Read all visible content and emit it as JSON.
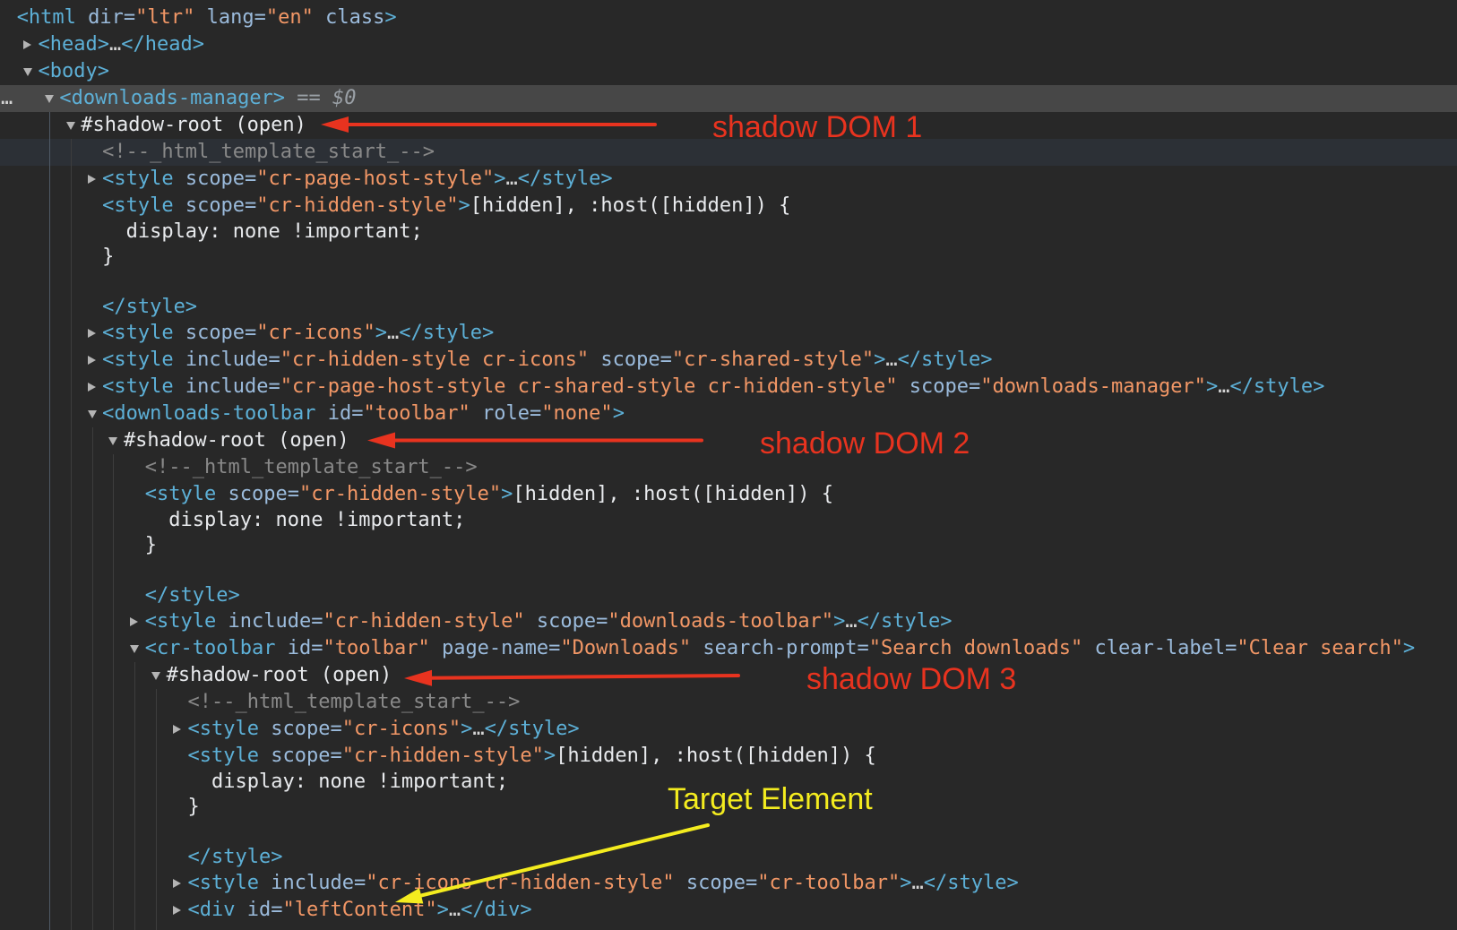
{
  "colors": {
    "background": "#282828",
    "tag": "#5db0d7",
    "attr": "#9bbbdc",
    "val": "#f29766",
    "text": "#e8eaed",
    "comment": "#898989",
    "shadow": "#e8eaed",
    "ell": "#d4d4d4",
    "ref": "#9aa0a6",
    "triangle": "#b4b4b4",
    "selected_row": "#474747",
    "hovered_row": "#2c3036",
    "guide": "#3d3d3d",
    "guide_active": "#4f5a66",
    "annotation_red": "#e8331f",
    "annotation_yellow": "#f4ec1f"
  },
  "tree": {
    "selected_gutter": "…",
    "rows": [
      {
        "level": 0,
        "type": "node",
        "toggle": "none",
        "tokens": [
          {
            "k": "tag",
            "t": "<html"
          },
          {
            "k": "attr",
            "t": " dir="
          },
          {
            "k": "val",
            "t": "\"ltr\""
          },
          {
            "k": "attr",
            "t": " lang="
          },
          {
            "k": "val",
            "t": "\"en\""
          },
          {
            "k": "attr",
            "t": " class"
          },
          {
            "k": "tag",
            "t": ">"
          }
        ]
      },
      {
        "level": 1,
        "type": "node",
        "toggle": "collapsed",
        "tokens": [
          {
            "k": "tag",
            "t": "<head>"
          },
          {
            "k": "ell",
            "t": "…"
          },
          {
            "k": "tag",
            "t": "</head>"
          }
        ]
      },
      {
        "level": 1,
        "type": "node",
        "toggle": "expanded",
        "tokens": [
          {
            "k": "tag",
            "t": "<body>"
          }
        ]
      },
      {
        "level": 2,
        "type": "node",
        "toggle": "expanded",
        "selected": true,
        "tokens": [
          {
            "k": "tag",
            "t": "<downloads-manager>"
          },
          {
            "k": "ref",
            "t": " == $0"
          }
        ]
      },
      {
        "level": 3,
        "type": "node",
        "toggle": "expanded",
        "tokens": [
          {
            "k": "shadow",
            "t": "#shadow-root (open)"
          }
        ]
      },
      {
        "level": 4,
        "type": "node",
        "toggle": "none",
        "hovered": true,
        "tokens": [
          {
            "k": "comment",
            "t": "<!--_html_template_start_-->"
          }
        ]
      },
      {
        "level": 4,
        "type": "node",
        "toggle": "collapsed",
        "tokens": [
          {
            "k": "tag",
            "t": "<style"
          },
          {
            "k": "attr",
            "t": " scope="
          },
          {
            "k": "val",
            "t": "\"cr-page-host-style\""
          },
          {
            "k": "tag",
            "t": ">"
          },
          {
            "k": "ell",
            "t": "…"
          },
          {
            "k": "tag",
            "t": "</style>"
          }
        ]
      },
      {
        "level": 4,
        "type": "node",
        "toggle": "none",
        "tokens": [
          {
            "k": "tag",
            "t": "<style"
          },
          {
            "k": "attr",
            "t": " scope="
          },
          {
            "k": "val",
            "t": "\"cr-hidden-style\""
          },
          {
            "k": "tag",
            "t": ">"
          },
          {
            "k": "text",
            "t": "[hidden], :host([hidden]) {"
          }
        ]
      },
      {
        "level": 4,
        "type": "line",
        "tokens": [
          {
            "k": "text",
            "t": "  display: none !important;"
          }
        ]
      },
      {
        "level": 4,
        "type": "line",
        "tokens": [
          {
            "k": "text",
            "t": "}"
          }
        ]
      },
      {
        "level": 4,
        "type": "line",
        "tokens": []
      },
      {
        "level": 4,
        "type": "line",
        "tokens": [
          {
            "k": "tag",
            "t": "</style>"
          }
        ]
      },
      {
        "level": 4,
        "type": "node",
        "toggle": "collapsed",
        "tokens": [
          {
            "k": "tag",
            "t": "<style"
          },
          {
            "k": "attr",
            "t": " scope="
          },
          {
            "k": "val",
            "t": "\"cr-icons\""
          },
          {
            "k": "tag",
            "t": ">"
          },
          {
            "k": "ell",
            "t": "…"
          },
          {
            "k": "tag",
            "t": "</style>"
          }
        ]
      },
      {
        "level": 4,
        "type": "node",
        "toggle": "collapsed",
        "tokens": [
          {
            "k": "tag",
            "t": "<style"
          },
          {
            "k": "attr",
            "t": " include="
          },
          {
            "k": "val",
            "t": "\"cr-hidden-style cr-icons\""
          },
          {
            "k": "attr",
            "t": " scope="
          },
          {
            "k": "val",
            "t": "\"cr-shared-style\""
          },
          {
            "k": "tag",
            "t": ">"
          },
          {
            "k": "ell",
            "t": "…"
          },
          {
            "k": "tag",
            "t": "</style>"
          }
        ]
      },
      {
        "level": 4,
        "type": "node",
        "toggle": "collapsed",
        "tokens": [
          {
            "k": "tag",
            "t": "<style"
          },
          {
            "k": "attr",
            "t": " include="
          },
          {
            "k": "val",
            "t": "\"cr-page-host-style cr-shared-style cr-hidden-style\""
          },
          {
            "k": "attr",
            "t": " scope="
          },
          {
            "k": "val",
            "t": "\"downloads-manager\""
          },
          {
            "k": "tag",
            "t": ">"
          },
          {
            "k": "ell",
            "t": "…"
          },
          {
            "k": "tag",
            "t": "</style>"
          }
        ]
      },
      {
        "level": 4,
        "type": "node",
        "toggle": "expanded",
        "tokens": [
          {
            "k": "tag",
            "t": "<downloads-toolbar"
          },
          {
            "k": "attr",
            "t": " id="
          },
          {
            "k": "val",
            "t": "\"toolbar\""
          },
          {
            "k": "attr",
            "t": " role="
          },
          {
            "k": "val",
            "t": "\"none\""
          },
          {
            "k": "tag",
            "t": ">"
          }
        ]
      },
      {
        "level": 5,
        "type": "node",
        "toggle": "expanded",
        "tokens": [
          {
            "k": "shadow",
            "t": "#shadow-root (open)"
          }
        ]
      },
      {
        "level": 6,
        "type": "node",
        "toggle": "none",
        "tokens": [
          {
            "k": "comment",
            "t": "<!--_html_template_start_-->"
          }
        ]
      },
      {
        "level": 6,
        "type": "node",
        "toggle": "none",
        "tokens": [
          {
            "k": "tag",
            "t": "<style"
          },
          {
            "k": "attr",
            "t": " scope="
          },
          {
            "k": "val",
            "t": "\"cr-hidden-style\""
          },
          {
            "k": "tag",
            "t": ">"
          },
          {
            "k": "text",
            "t": "[hidden], :host([hidden]) {"
          }
        ]
      },
      {
        "level": 6,
        "type": "line",
        "tokens": [
          {
            "k": "text",
            "t": "  display: none !important;"
          }
        ]
      },
      {
        "level": 6,
        "type": "line",
        "tokens": [
          {
            "k": "text",
            "t": "}"
          }
        ]
      },
      {
        "level": 6,
        "type": "line",
        "tokens": []
      },
      {
        "level": 6,
        "type": "line",
        "tokens": [
          {
            "k": "tag",
            "t": "</style>"
          }
        ]
      },
      {
        "level": 6,
        "type": "node",
        "toggle": "collapsed",
        "tokens": [
          {
            "k": "tag",
            "t": "<style"
          },
          {
            "k": "attr",
            "t": " include="
          },
          {
            "k": "val",
            "t": "\"cr-hidden-style\""
          },
          {
            "k": "attr",
            "t": " scope="
          },
          {
            "k": "val",
            "t": "\"downloads-toolbar\""
          },
          {
            "k": "tag",
            "t": ">"
          },
          {
            "k": "ell",
            "t": "…"
          },
          {
            "k": "tag",
            "t": "</style>"
          }
        ]
      },
      {
        "level": 6,
        "type": "node",
        "toggle": "expanded",
        "tokens": [
          {
            "k": "tag",
            "t": "<cr-toolbar"
          },
          {
            "k": "attr",
            "t": " id="
          },
          {
            "k": "val",
            "t": "\"toolbar\""
          },
          {
            "k": "attr",
            "t": " page-name="
          },
          {
            "k": "val",
            "t": "\"Downloads\""
          },
          {
            "k": "attr",
            "t": " search-prompt="
          },
          {
            "k": "val",
            "t": "\"Search downloads\""
          },
          {
            "k": "attr",
            "t": " clear-label="
          },
          {
            "k": "val",
            "t": "\"Clear search\""
          },
          {
            "k": "tag",
            "t": ">"
          }
        ]
      },
      {
        "level": 7,
        "type": "node",
        "toggle": "expanded",
        "tokens": [
          {
            "k": "shadow",
            "t": "#shadow-root (open)"
          }
        ]
      },
      {
        "level": 8,
        "type": "node",
        "toggle": "none",
        "tokens": [
          {
            "k": "comment",
            "t": "<!--_html_template_start_-->"
          }
        ]
      },
      {
        "level": 8,
        "type": "node",
        "toggle": "collapsed",
        "tokens": [
          {
            "k": "tag",
            "t": "<style"
          },
          {
            "k": "attr",
            "t": " scope="
          },
          {
            "k": "val",
            "t": "\"cr-icons\""
          },
          {
            "k": "tag",
            "t": ">"
          },
          {
            "k": "ell",
            "t": "…"
          },
          {
            "k": "tag",
            "t": "</style>"
          }
        ]
      },
      {
        "level": 8,
        "type": "node",
        "toggle": "none",
        "tokens": [
          {
            "k": "tag",
            "t": "<style"
          },
          {
            "k": "attr",
            "t": " scope="
          },
          {
            "k": "val",
            "t": "\"cr-hidden-style\""
          },
          {
            "k": "tag",
            "t": ">"
          },
          {
            "k": "text",
            "t": "[hidden], :host([hidden]) {"
          }
        ]
      },
      {
        "level": 8,
        "type": "line",
        "tokens": [
          {
            "k": "text",
            "t": "  display: none !important;"
          }
        ]
      },
      {
        "level": 8,
        "type": "line",
        "tokens": [
          {
            "k": "text",
            "t": "}"
          }
        ]
      },
      {
        "level": 8,
        "type": "line",
        "tokens": []
      },
      {
        "level": 8,
        "type": "line",
        "tokens": [
          {
            "k": "tag",
            "t": "</style>"
          }
        ]
      },
      {
        "level": 8,
        "type": "node",
        "toggle": "collapsed",
        "tokens": [
          {
            "k": "tag",
            "t": "<style"
          },
          {
            "k": "attr",
            "t": " include="
          },
          {
            "k": "val",
            "t": "\"cr-icons cr-hidden-style\""
          },
          {
            "k": "attr",
            "t": " scope="
          },
          {
            "k": "val",
            "t": "\"cr-toolbar\""
          },
          {
            "k": "tag",
            "t": ">"
          },
          {
            "k": "ell",
            "t": "…"
          },
          {
            "k": "tag",
            "t": "</style>"
          }
        ]
      },
      {
        "level": 8,
        "type": "node",
        "toggle": "collapsed",
        "tokens": [
          {
            "k": "tag",
            "t": "<div"
          },
          {
            "k": "attr",
            "t": " id="
          },
          {
            "k": "val",
            "t": "\"leftContent\""
          },
          {
            "k": "tag",
            "t": ">"
          },
          {
            "k": "ell",
            "t": "…"
          },
          {
            "k": "tag",
            "t": "</div>"
          }
        ]
      }
    ]
  },
  "annotations": {
    "shadow_dom_1": "shadow DOM 1",
    "shadow_dom_2": "shadow DOM 2",
    "shadow_dom_3": "shadow DOM 3",
    "target": "Target Element"
  }
}
